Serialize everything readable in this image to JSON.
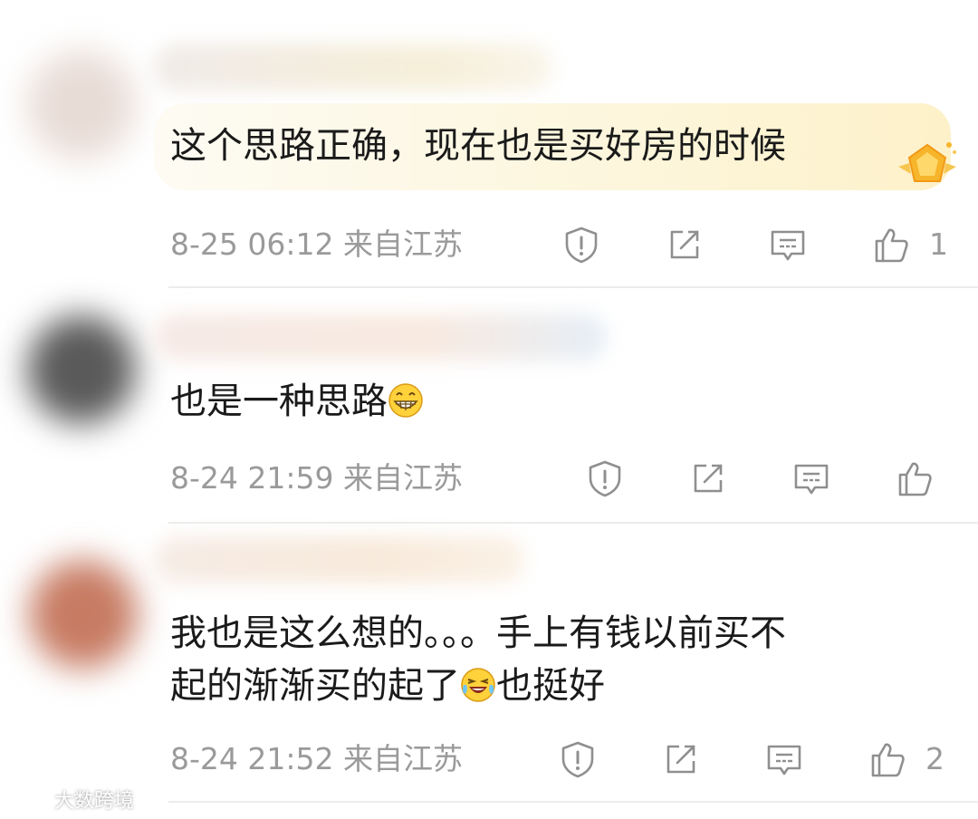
{
  "comments": [
    {
      "text_lines": [
        "这个思路正确，现在也是买好房的时候"
      ],
      "date": "8-25 06:12",
      "location": "来自江苏",
      "likes": "1",
      "has_fan_badge": true
    },
    {
      "text_lines": [
        "也是一种思路"
      ],
      "inline_emoji": "grin-emoji",
      "date": "8-24 21:59",
      "location": "来自江苏",
      "likes": ""
    },
    {
      "text_lines": [
        "我也是这么想的。。。手上有钱以前买不",
        "起的渐渐买的起了"
      ],
      "inline_emoji": "laugh-cry-emoji",
      "text_after_emoji": "也挺好",
      "date": "8-24 21:52",
      "location": "来自江苏",
      "likes": "2"
    }
  ],
  "actions": {
    "report_icon": "shield-exclamation-icon",
    "repost_icon": "square-arrow-icon",
    "reply_icon": "comment-bubble-icon",
    "like_icon": "thumbs-up-icon"
  },
  "watermark": {
    "text": "大数跨境"
  },
  "colors": {
    "text": "#1a1a1a",
    "meta": "#9a9a9a",
    "highlight": "#fdf6dc",
    "badge": "#f7b52b",
    "divider": "#ececec"
  }
}
